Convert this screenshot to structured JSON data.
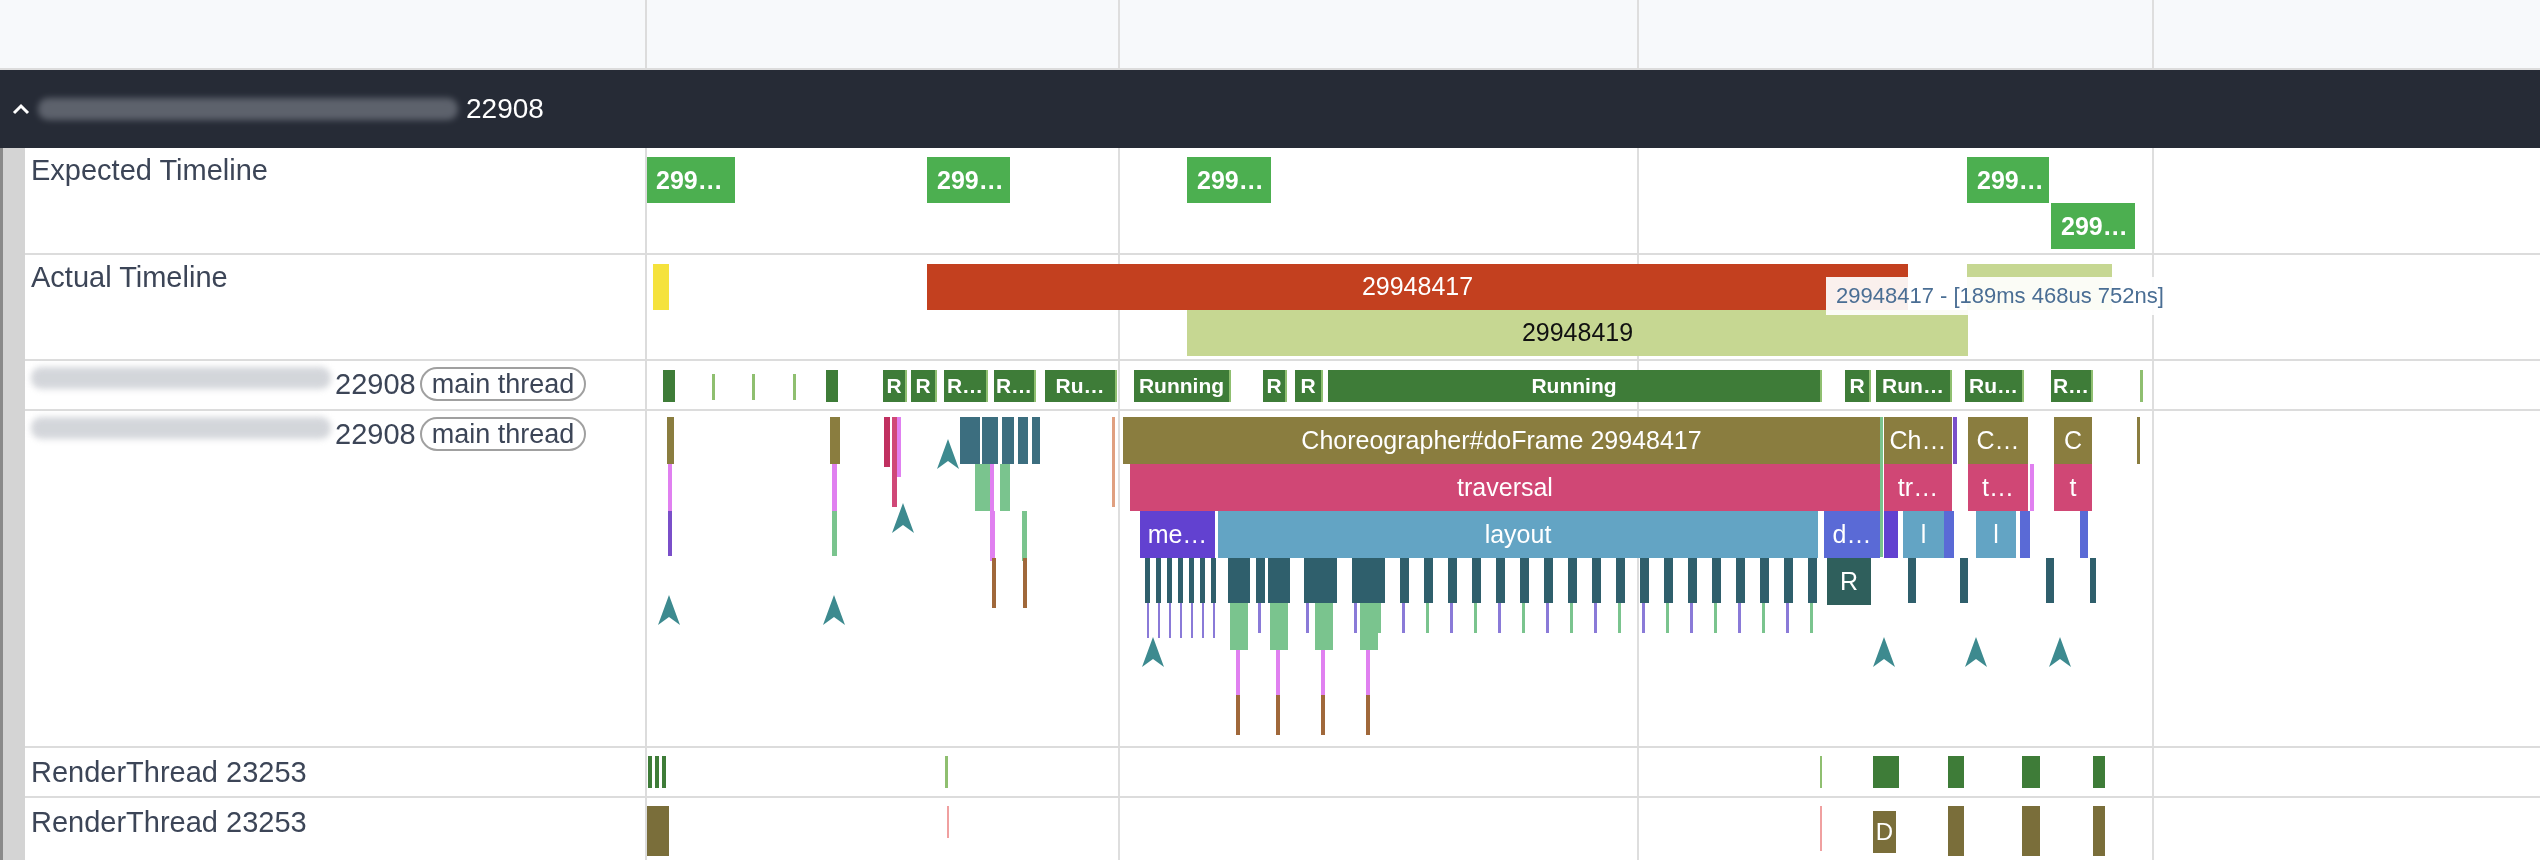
{
  "process": {
    "pid": "22908",
    "expanded": true
  },
  "expected": {
    "label": "Expected Timeline",
    "slices": [
      {
        "text": "299…"
      },
      {
        "text": "299…"
      },
      {
        "text": "299…"
      },
      {
        "text": "299…"
      },
      {
        "text": "299…"
      }
    ]
  },
  "actual": {
    "label": "Actual Timeline",
    "slices": [
      {
        "text": "29948417",
        "color": "#c3401f"
      },
      {
        "text": "29948419",
        "color": "#c6d792"
      }
    ],
    "tooltip": "29948417 - [189ms 468us 752ns]"
  },
  "thread_state": {
    "pid": "22908",
    "tag": "main thread",
    "slices": [
      {
        "text": "R"
      },
      {
        "text": "R"
      },
      {
        "text": "R…"
      },
      {
        "text": "R…"
      },
      {
        "text": "Ru…"
      },
      {
        "text": "Running"
      },
      {
        "text": "R"
      },
      {
        "text": "R"
      },
      {
        "text": "Running"
      },
      {
        "text": "R"
      },
      {
        "text": "Run…"
      },
      {
        "text": "Ru…"
      },
      {
        "text": "R…"
      }
    ]
  },
  "main_thread": {
    "pid": "22908",
    "tag": "main thread",
    "slices": [
      {
        "text": "Choreographer#doFrame 29948417",
        "color": "#8a7d3f"
      },
      {
        "text": "Ch…",
        "color": "#8a7d3f"
      },
      {
        "text": "C…",
        "color": "#8a7d3f"
      },
      {
        "text": "C",
        "color": "#8a7d3f"
      },
      {
        "text": "traversal",
        "color": "#d04775"
      },
      {
        "text": "tr…",
        "color": "#d04775"
      },
      {
        "text": "t…",
        "color": "#d04775"
      },
      {
        "text": "t",
        "color": "#d04775"
      },
      {
        "text": "me…",
        "color": "#6241d0"
      },
      {
        "text": "layout",
        "color": "#63a4c4"
      },
      {
        "text": "d…",
        "color": "#5a6ad6"
      },
      {
        "text": "l",
        "color": "#63a4c4"
      },
      {
        "text": "l",
        "color": "#63a4c4"
      },
      {
        "text": "R",
        "color": "#2f5f5c"
      }
    ]
  },
  "render_threads": [
    {
      "label": "RenderThread 23253"
    },
    {
      "label": "RenderThread 23253",
      "slices": [
        {
          "text": "D"
        }
      ]
    }
  ]
}
